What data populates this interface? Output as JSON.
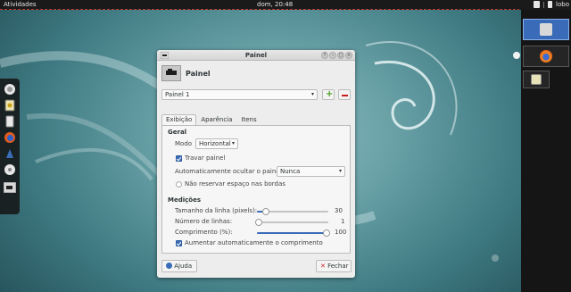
{
  "topbar": {
    "activities": "Atividades",
    "clock": "dom, 20:48",
    "user": "lobo"
  },
  "dialog": {
    "window_title": "Painel",
    "header_title": "Painel",
    "panel_select": "Painel 1",
    "tabs": [
      {
        "label": "Exibição",
        "active": true
      },
      {
        "label": "Aparência",
        "active": false
      },
      {
        "label": "Itens",
        "active": false
      }
    ],
    "geral": {
      "heading": "Geral",
      "mode_label": "Modo",
      "mode_value": "Horizontal",
      "lock_label": "Travar painel",
      "lock_checked": true,
      "autohide_label": "Automaticamente ocultar o painel:",
      "autohide_value": "Nunca",
      "reserve_label": "Não reservar espaço nas bordas",
      "reserve_checked": false
    },
    "medicoes": {
      "heading": "Medições",
      "row_size_label": "Tamanho da linha (pixels):",
      "row_size_value": "30",
      "rows_label": "Número de linhas:",
      "rows_value": "1",
      "length_label": "Comprimento (%):",
      "length_value": "100",
      "autogrow_label": "Aumentar automaticamente o comprimento",
      "autogrow_checked": true
    },
    "help_button": "Ajuda",
    "close_button": "Fechar"
  },
  "colors": {
    "accent": "#3a6db8",
    "topbar_bg": "#1a1a1a",
    "add_green": "#4b9d19",
    "remove_red": "#cc1d1d"
  }
}
